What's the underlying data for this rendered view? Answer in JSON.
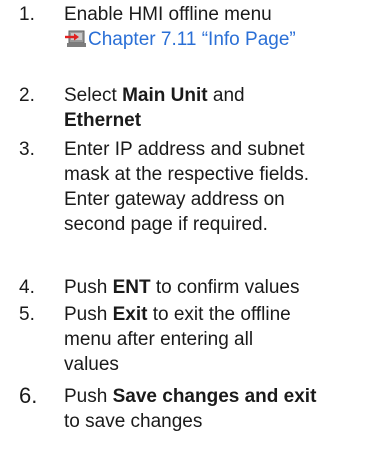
{
  "steps": [
    {
      "number": "1.",
      "lines": [
        "Enable HMI offline menu"
      ],
      "link": {
        "icon": "cross-reference-icon",
        "text": "Chapter 7.11 “Info Page”",
        "color": "#2a6fd6"
      }
    },
    {
      "number": "2.",
      "parts": {
        "select": "Select ",
        "main_unit": "Main Unit",
        "and": " and",
        "ethernet": "Ethernet"
      }
    },
    {
      "number": "3.",
      "lines": [
        "Enter IP address and subnet",
        "mask at the respective fields.",
        "Enter gateway address on",
        "second page if required."
      ]
    },
    {
      "number": "4.",
      "parts": {
        "push": "Push ",
        "ent": "ENT",
        "rest": " to confirm values"
      }
    },
    {
      "number": "5.",
      "parts": {
        "push": "Push ",
        "exit": "Exit",
        "rest": " to exit the offline"
      },
      "lines": [
        "menu after entering all",
        "values"
      ]
    },
    {
      "number": "6.",
      "parts": {
        "push": "Push ",
        "save": "Save changes and exit"
      },
      "lines": [
        "to save changes"
      ]
    }
  ]
}
